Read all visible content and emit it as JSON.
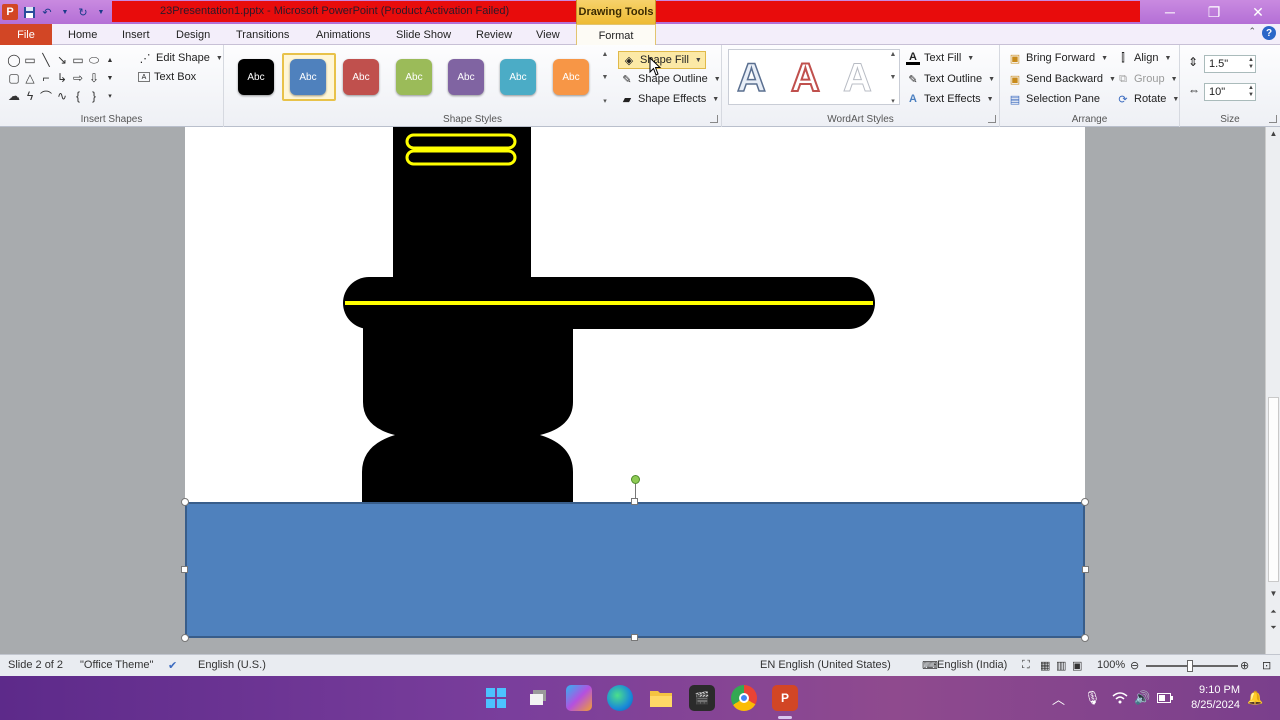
{
  "window": {
    "title": "23Presentation1.pptx  -  Microsoft PowerPoint (Product Activation Failed)",
    "context_tab_group": "Drawing Tools",
    "controls": {
      "minimize": "─",
      "restore": "❐",
      "close": "✕"
    }
  },
  "tabs": {
    "file": "File",
    "items": [
      "Home",
      "Insert",
      "Design",
      "Transitions",
      "Animations",
      "Slide Show",
      "Review",
      "View"
    ],
    "format": "Format"
  },
  "ribbon": {
    "insert_shapes": {
      "label": "Insert Shapes",
      "edit_shape": "Edit Shape",
      "text_box": "Text Box"
    },
    "shape_styles": {
      "label": "Shape Styles",
      "swatch_text": "Abc",
      "swatch_colors": [
        "#000000",
        "#4f81bd",
        "#c0504d",
        "#9bbb59",
        "#8064a2",
        "#4bacc6",
        "#f79646"
      ],
      "shape_fill": "Shape Fill",
      "shape_outline": "Shape Outline",
      "shape_effects": "Shape Effects"
    },
    "wordart": {
      "label": "WordArt Styles",
      "letter": "A",
      "text_fill": "Text Fill",
      "text_outline": "Text Outline",
      "text_effects": "Text Effects"
    },
    "arrange": {
      "label": "Arrange",
      "bring_forward": "Bring Forward",
      "send_backward": "Send Backward",
      "selection_pane": "Selection Pane",
      "align": "Align",
      "group": "Group",
      "rotate": "Rotate"
    },
    "size": {
      "label": "Size",
      "height": "1.5\"",
      "width": "10\""
    }
  },
  "status": {
    "slide": "Slide 2 of 2",
    "theme": "\"Office Theme\"",
    "language": "English (U.S.)",
    "input_lang": "EN English (United States)",
    "keyboard": "English (India)",
    "zoom": "100%"
  },
  "taskbar": {
    "time": "9:10 PM",
    "date": "8/25/2024"
  },
  "colors": {
    "selected_fill": "#4f81bd",
    "shape_black": "#000000",
    "stripe_yellow": "#ffff00"
  }
}
